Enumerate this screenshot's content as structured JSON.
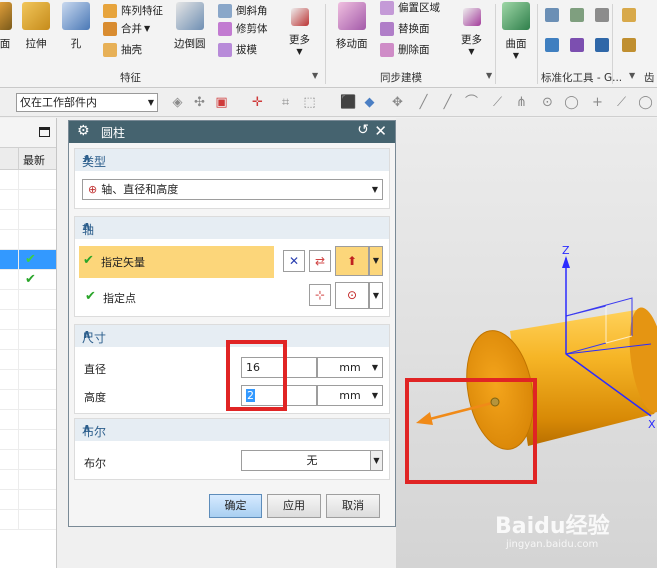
{
  "ribbon": {
    "feature_group": {
      "label": "特征",
      "buttons": [
        "面",
        "拉伸",
        "孔",
        "阵列特征",
        "合并",
        "抽壳",
        "边倒圆",
        "倒斜角",
        "修剪体",
        "拔模",
        "更多"
      ]
    },
    "sync_group": {
      "label": "同步建模",
      "buttons": [
        "移动面",
        "偏置区域",
        "替换面",
        "删除面",
        "更多"
      ]
    },
    "surface_group": {
      "buttons": [
        "曲面"
      ]
    },
    "std_group": {
      "label": "标准化工具 - G..."
    },
    "extra_label": "齿"
  },
  "filterbar": {
    "scope_value": "仅在工作部件内"
  },
  "navigator": {
    "column_header": "最新"
  },
  "dialog": {
    "title": "圆柱",
    "type_section": {
      "header": "类型",
      "value": "轴、直径和高度"
    },
    "axis_section": {
      "header": "轴",
      "vector_label": "指定矢量",
      "point_label": "指定点"
    },
    "dims_section": {
      "header": "尺寸",
      "diameter_label": "直径",
      "diameter_value": "16",
      "diameter_unit": "mm",
      "height_label": "高度",
      "height_value": "2",
      "height_unit": "mm"
    },
    "bool_section": {
      "header": "布尔",
      "label": "布尔",
      "value": "无"
    },
    "buttons": {
      "ok": "确定",
      "apply": "应用",
      "cancel": "取消"
    }
  },
  "viewport": {
    "axis_z": "Z",
    "axis_x": "X",
    "watermark": "Baidu经验",
    "watermark_url": "jingyan.baidu.com"
  },
  "colors": {
    "accent_red": "#e02424",
    "cylinder": "#f0a010",
    "dialog_title": "#45636f",
    "selection": "#3399ff"
  },
  "icons": [
    "gear-icon",
    "reset-icon",
    "close-icon",
    "checkmark-icon",
    "vector-icon",
    "point-icon",
    "chevron-down-icon",
    "collapse-icon"
  ]
}
